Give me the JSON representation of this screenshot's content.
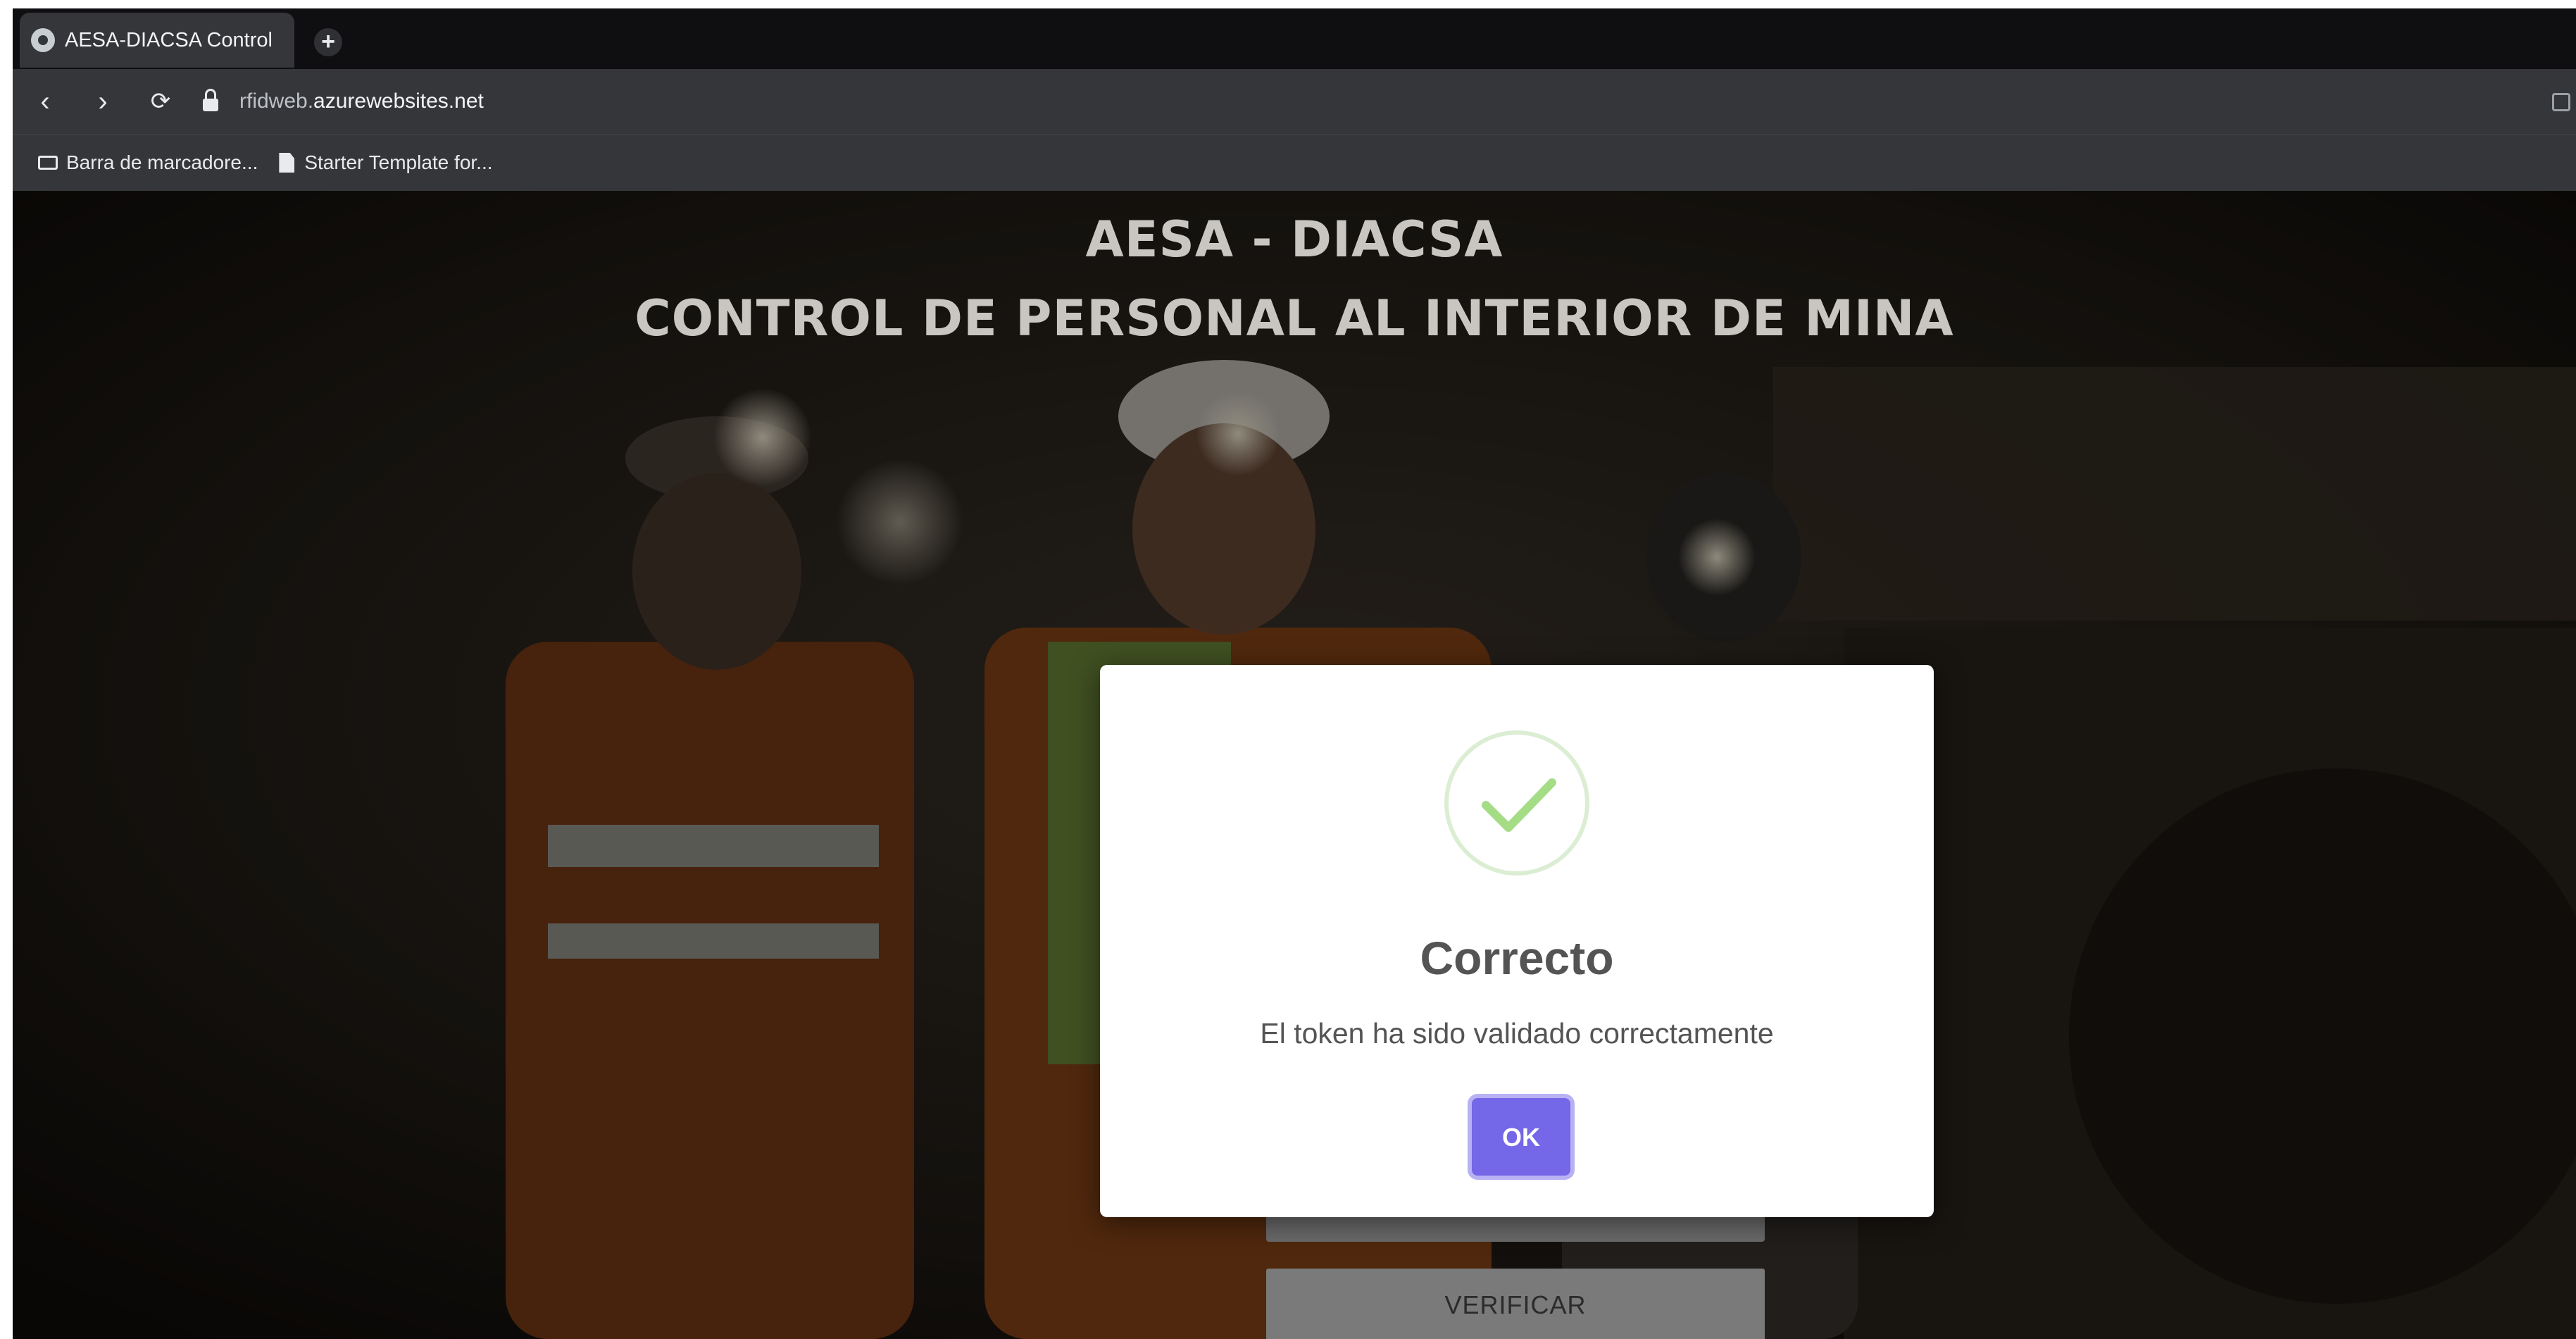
{
  "browser": {
    "tab_title": "AESA-DIACSA Control",
    "new_tab_symbol": "+",
    "url_subdomain": "rfidweb.",
    "url_domain": "azurewebsites.net",
    "bookmarks": [
      {
        "label": "Barra de marcadore...",
        "icon": "folder-icon"
      },
      {
        "label": "Starter Template for...",
        "icon": "page-icon"
      }
    ]
  },
  "page": {
    "title_line1": "AESA - DIACSA",
    "title_line2": "CONTROL DE PERSONAL AL INTERIOR DE MINA",
    "verify_label": "VERIFICAR"
  },
  "modal": {
    "title": "Correcto",
    "message": "El token ha sido validado correctamente",
    "ok_label": "OK",
    "icon": "success-check-icon",
    "accent_color": "#7467e8",
    "check_color": "#a5dc86"
  }
}
